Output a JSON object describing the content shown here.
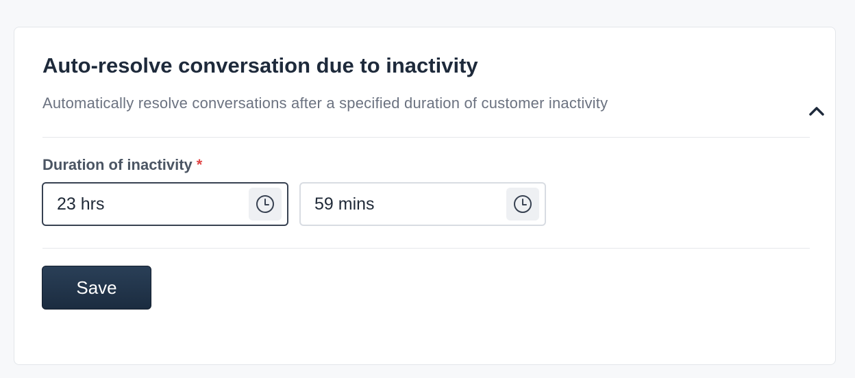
{
  "section": {
    "title": "Auto-resolve conversation due to inactivity",
    "subtitle": "Automatically resolve conversations after a specified duration of customer inactivity"
  },
  "duration": {
    "label": "Duration of inactivity",
    "required_marker": "*",
    "hours": {
      "value": "23 hrs",
      "icon": "clock-icon"
    },
    "minutes": {
      "value": "59 mins",
      "icon": "clock-icon"
    }
  },
  "actions": {
    "save_label": "Save"
  },
  "icons": {
    "collapse": "chevron-up-icon"
  },
  "colors": {
    "title": "#1e2a3b",
    "subtitle": "#6b7280",
    "required": "#e04646",
    "button": "#1f3348"
  }
}
